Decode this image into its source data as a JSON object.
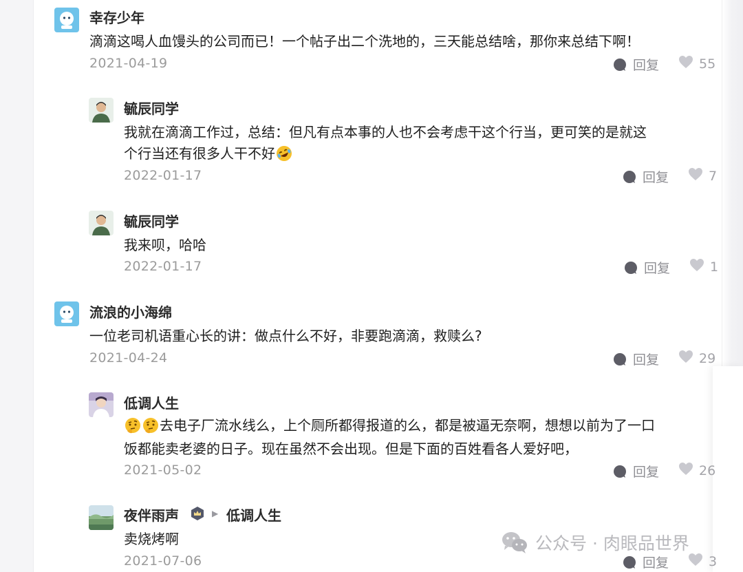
{
  "comments": [
    {
      "author": "幸存少年",
      "text": "滴滴这喝人血馒头的公司而已！一个帖子出二个洗地的，三天能总结啥，那你来总结下啊！",
      "date": "2021-04-19",
      "reply_label": "回复",
      "likes": "55",
      "replies": [
        {
          "author": "毓辰同学",
          "text_line1": "我就在滴滴工作过，总结：但凡有点本事的人也不会考虑干这个行当，更可笑的是就这",
          "text_line2": "个行当还有很多人干不好",
          "emoji": "rolling-on-floor-laughing-emoji",
          "date": "2022-01-17",
          "reply_label": "回复",
          "likes": "7"
        },
        {
          "author": "毓辰同学",
          "text": "我来呗，哈哈",
          "date": "2022-01-17",
          "reply_label": "回复",
          "likes": "1"
        }
      ]
    },
    {
      "author": "流浪的小海绵",
      "text": "一位老司机语重心长的讲：做点什么不好，非要跑滴滴，救赎么?",
      "date": "2021-04-24",
      "reply_label": "回复",
      "likes": "29",
      "replies": [
        {
          "author": "低调人生",
          "emoji": "thinking-face-emoji",
          "text_line1": "去电子厂流水线么，上个厕所都得报道的么，都是被逼无奈啊，想想以前为了一口",
          "text_line2": "饭都能卖老婆的日子。现在虽然不会出现。但是下面的百姓看各人爱好吧，",
          "date": "2021-05-02",
          "reply_label": "回复",
          "likes": "26"
        },
        {
          "author": "夜伴雨声",
          "reply_to": "低调人生",
          "text": "卖烧烤啊",
          "date": "2021-07-06",
          "reply_label": "回复",
          "likes": "3"
        }
      ]
    }
  ],
  "watermark": "公众号 · 肉眼品世界",
  "colors": {
    "name": "#2b2b2b",
    "text": "#1f1f1f",
    "meta": "#9b9b9b",
    "icon": "#8f8f94",
    "avatar_blue": "#6fc3ea"
  }
}
